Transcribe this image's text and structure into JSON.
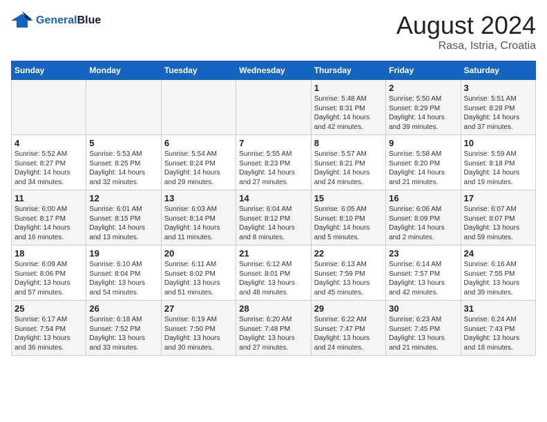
{
  "header": {
    "logo_general": "General",
    "logo_blue": "Blue",
    "month_year": "August 2024",
    "location": "Rasa, Istria, Croatia"
  },
  "days_of_week": [
    "Sunday",
    "Monday",
    "Tuesday",
    "Wednesday",
    "Thursday",
    "Friday",
    "Saturday"
  ],
  "weeks": [
    [
      {
        "day": "",
        "content": ""
      },
      {
        "day": "",
        "content": ""
      },
      {
        "day": "",
        "content": ""
      },
      {
        "day": "",
        "content": ""
      },
      {
        "day": "1",
        "content": "Sunrise: 5:48 AM\nSunset: 8:31 PM\nDaylight: 14 hours and 42 minutes."
      },
      {
        "day": "2",
        "content": "Sunrise: 5:50 AM\nSunset: 8:29 PM\nDaylight: 14 hours and 39 minutes."
      },
      {
        "day": "3",
        "content": "Sunrise: 5:51 AM\nSunset: 8:28 PM\nDaylight: 14 hours and 37 minutes."
      }
    ],
    [
      {
        "day": "4",
        "content": "Sunrise: 5:52 AM\nSunset: 8:27 PM\nDaylight: 14 hours and 34 minutes."
      },
      {
        "day": "5",
        "content": "Sunrise: 5:53 AM\nSunset: 8:25 PM\nDaylight: 14 hours and 32 minutes."
      },
      {
        "day": "6",
        "content": "Sunrise: 5:54 AM\nSunset: 8:24 PM\nDaylight: 14 hours and 29 minutes."
      },
      {
        "day": "7",
        "content": "Sunrise: 5:55 AM\nSunset: 8:23 PM\nDaylight: 14 hours and 27 minutes."
      },
      {
        "day": "8",
        "content": "Sunrise: 5:57 AM\nSunset: 8:21 PM\nDaylight: 14 hours and 24 minutes."
      },
      {
        "day": "9",
        "content": "Sunrise: 5:58 AM\nSunset: 8:20 PM\nDaylight: 14 hours and 21 minutes."
      },
      {
        "day": "10",
        "content": "Sunrise: 5:59 AM\nSunset: 8:18 PM\nDaylight: 14 hours and 19 minutes."
      }
    ],
    [
      {
        "day": "11",
        "content": "Sunrise: 6:00 AM\nSunset: 8:17 PM\nDaylight: 14 hours and 16 minutes."
      },
      {
        "day": "12",
        "content": "Sunrise: 6:01 AM\nSunset: 8:15 PM\nDaylight: 14 hours and 13 minutes."
      },
      {
        "day": "13",
        "content": "Sunrise: 6:03 AM\nSunset: 8:14 PM\nDaylight: 14 hours and 11 minutes."
      },
      {
        "day": "14",
        "content": "Sunrise: 6:04 AM\nSunset: 8:12 PM\nDaylight: 14 hours and 8 minutes."
      },
      {
        "day": "15",
        "content": "Sunrise: 6:05 AM\nSunset: 8:10 PM\nDaylight: 14 hours and 5 minutes."
      },
      {
        "day": "16",
        "content": "Sunrise: 6:06 AM\nSunset: 8:09 PM\nDaylight: 14 hours and 2 minutes."
      },
      {
        "day": "17",
        "content": "Sunrise: 6:07 AM\nSunset: 8:07 PM\nDaylight: 13 hours and 59 minutes."
      }
    ],
    [
      {
        "day": "18",
        "content": "Sunrise: 6:09 AM\nSunset: 8:06 PM\nDaylight: 13 hours and 57 minutes."
      },
      {
        "day": "19",
        "content": "Sunrise: 6:10 AM\nSunset: 8:04 PM\nDaylight: 13 hours and 54 minutes."
      },
      {
        "day": "20",
        "content": "Sunrise: 6:11 AM\nSunset: 8:02 PM\nDaylight: 13 hours and 51 minutes."
      },
      {
        "day": "21",
        "content": "Sunrise: 6:12 AM\nSunset: 8:01 PM\nDaylight: 13 hours and 48 minutes."
      },
      {
        "day": "22",
        "content": "Sunrise: 6:13 AM\nSunset: 7:59 PM\nDaylight: 13 hours and 45 minutes."
      },
      {
        "day": "23",
        "content": "Sunrise: 6:14 AM\nSunset: 7:57 PM\nDaylight: 13 hours and 42 minutes."
      },
      {
        "day": "24",
        "content": "Sunrise: 6:16 AM\nSunset: 7:55 PM\nDaylight: 13 hours and 39 minutes."
      }
    ],
    [
      {
        "day": "25",
        "content": "Sunrise: 6:17 AM\nSunset: 7:54 PM\nDaylight: 13 hours and 36 minutes."
      },
      {
        "day": "26",
        "content": "Sunrise: 6:18 AM\nSunset: 7:52 PM\nDaylight: 13 hours and 33 minutes."
      },
      {
        "day": "27",
        "content": "Sunrise: 6:19 AM\nSunset: 7:50 PM\nDaylight: 13 hours and 30 minutes."
      },
      {
        "day": "28",
        "content": "Sunrise: 6:20 AM\nSunset: 7:48 PM\nDaylight: 13 hours and 27 minutes."
      },
      {
        "day": "29",
        "content": "Sunrise: 6:22 AM\nSunset: 7:47 PM\nDaylight: 13 hours and 24 minutes."
      },
      {
        "day": "30",
        "content": "Sunrise: 6:23 AM\nSunset: 7:45 PM\nDaylight: 13 hours and 21 minutes."
      },
      {
        "day": "31",
        "content": "Sunrise: 6:24 AM\nSunset: 7:43 PM\nDaylight: 13 hours and 18 minutes."
      }
    ]
  ]
}
